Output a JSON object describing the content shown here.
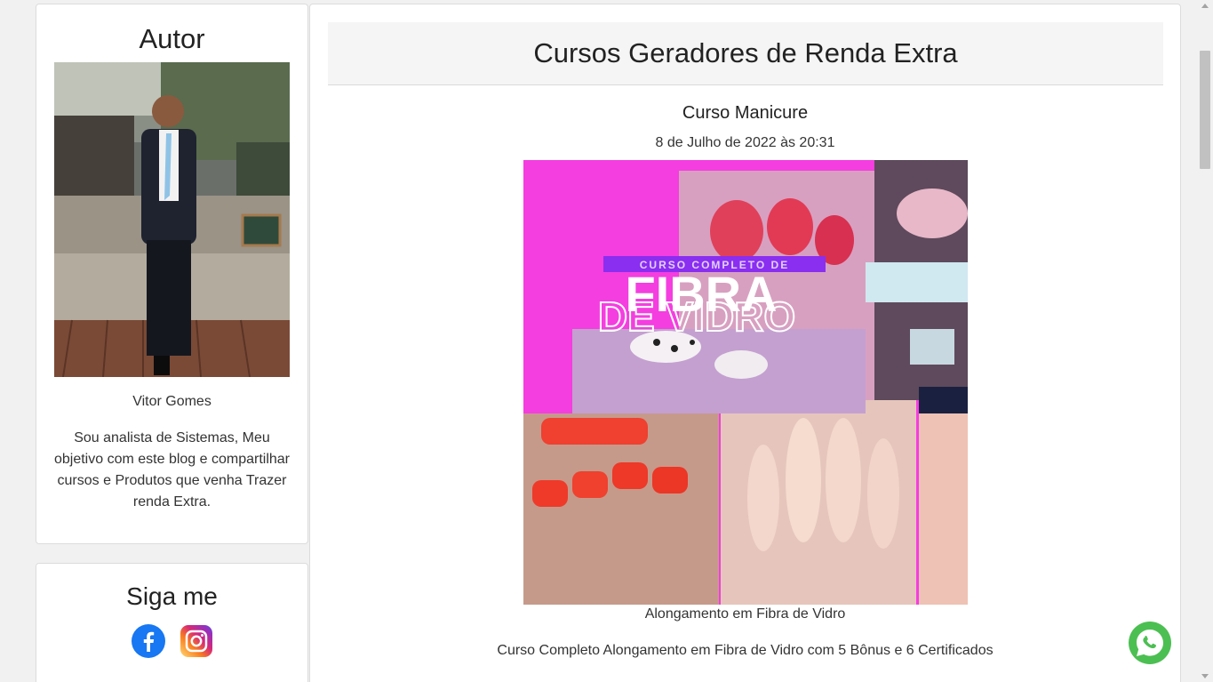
{
  "author": {
    "heading": "Autor",
    "name": "Vitor Gomes",
    "bio": "Sou analista de Sistemas, Meu objetivo com este blog e compartilhar cursos e Produtos que venha Trazer renda Extra."
  },
  "follow": {
    "heading": "Siga me",
    "icons": [
      "facebook-icon",
      "instagram-icon"
    ]
  },
  "main": {
    "header": "Cursos Geradores de Renda Extra",
    "post": {
      "title": "Curso Manicure",
      "date": "8 de Julho de 2022 às 20:31",
      "image_text_small": "CURSO COMPLETO DE",
      "image_text_line1": "FIBRA",
      "image_text_line2": "DE VIDRO",
      "caption": "Alongamento em Fibra de Vidro",
      "description": "Curso Completo Alongamento em Fibra de Vidro com 5 Bônus e 6 Certificados"
    }
  },
  "colors": {
    "whatsapp": "#4cbf52",
    "facebook": "#1877f2",
    "image_magenta": "#f43ee0"
  }
}
